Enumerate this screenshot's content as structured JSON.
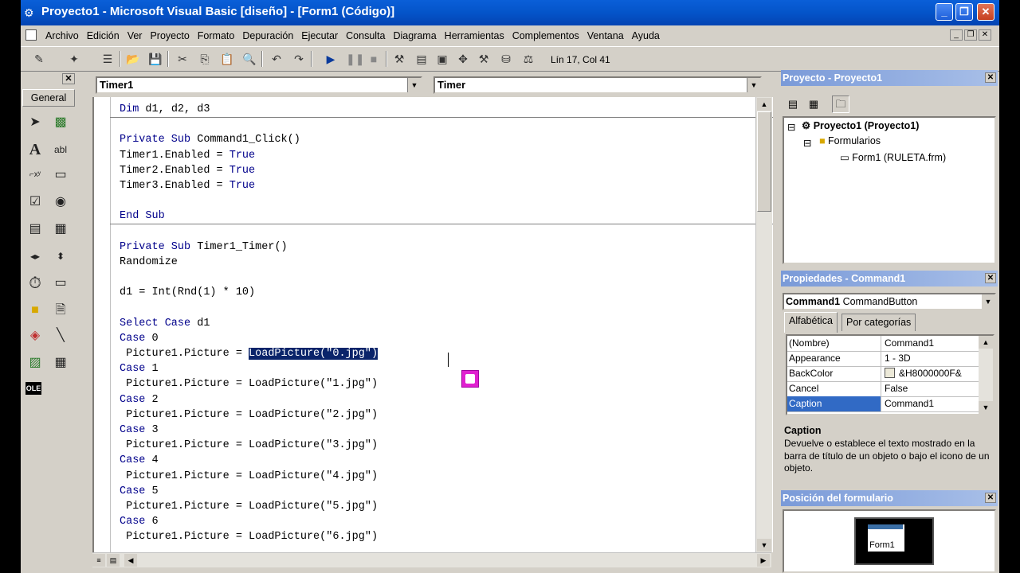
{
  "window": {
    "title": "Proyecto1 - Microsoft Visual Basic [diseño] - [Form1 (Código)]",
    "min_label": "_",
    "max_label": "❐",
    "close_label": "✕"
  },
  "menu": [
    "Archivo",
    "Edición",
    "Ver",
    "Proyecto",
    "Formato",
    "Depuración",
    "Ejecutar",
    "Consulta",
    "Diagrama",
    "Herramientas",
    "Complementos",
    "Ventana",
    "Ayuda"
  ],
  "toolbar": {
    "position_label": "Lín 17, Col 41"
  },
  "toolbox": {
    "close_label": "✕",
    "tab_label": "General"
  },
  "code_window": {
    "object_combo": "Timer1",
    "procedure_combo": "Timer",
    "lines": [
      {
        "text": "Dim d1, d2, d3",
        "kw": "Dim"
      },
      {
        "text": "",
        "kw": ""
      },
      {
        "text": "Private Sub Command1_Click()",
        "kw": "Private Sub"
      },
      {
        "text": "Timer1.Enabled = True",
        "kw": ""
      },
      {
        "text": "Timer2.Enabled = True",
        "kw": ""
      },
      {
        "text": "Timer3.Enabled = True",
        "kw": ""
      },
      {
        "text": "",
        "kw": ""
      },
      {
        "text": "End Sub",
        "kw": "End Sub"
      },
      {
        "text": "",
        "kw": ""
      },
      {
        "text": "Private Sub Timer1_Timer()",
        "kw": "Private Sub"
      },
      {
        "text": "Randomize",
        "kw": ""
      },
      {
        "text": "",
        "kw": ""
      },
      {
        "text": "d1 = Int(Rnd(1) * 10)",
        "kw": ""
      },
      {
        "text": "",
        "kw": ""
      },
      {
        "text": "Select Case d1",
        "kw": "Select Case"
      },
      {
        "text": "Case 0",
        "kw": "Case"
      },
      {
        "text": " Picture1.Picture = LoadPicture(\"0.jpg\")",
        "kw": ""
      },
      {
        "text": "Case 1",
        "kw": "Case"
      },
      {
        "text": " Picture1.Picture = LoadPicture(\"1.jpg\")",
        "kw": ""
      },
      {
        "text": "Case 2",
        "kw": "Case"
      },
      {
        "text": " Picture1.Picture = LoadPicture(\"2.jpg\")",
        "kw": ""
      },
      {
        "text": "Case 3",
        "kw": "Case"
      },
      {
        "text": " Picture1.Picture = LoadPicture(\"3.jpg\")",
        "kw": ""
      },
      {
        "text": "Case 4",
        "kw": "Case"
      },
      {
        "text": " Picture1.Picture = LoadPicture(\"4.jpg\")",
        "kw": ""
      },
      {
        "text": "Case 5",
        "kw": "Case"
      },
      {
        "text": " Picture1.Picture = LoadPicture(\"5.jpg\")",
        "kw": ""
      },
      {
        "text": "Case 6",
        "kw": "Case"
      },
      {
        "text": " Picture1.Picture = LoadPicture(\"6.jpg\")",
        "kw": ""
      }
    ],
    "selected_text": "LoadPicture(\"0.jpg\")"
  },
  "project_panel": {
    "title": "Proyecto - Proyecto1",
    "tree": {
      "root": "Proyecto1 (Proyecto1)",
      "folder": "Formularios",
      "item": "Form1 (RULETA.frm)"
    }
  },
  "properties_panel": {
    "title": "Propiedades - Command1",
    "object_name": "Command1",
    "object_type": "CommandButton",
    "tabs": [
      "Alfabética",
      "Por categorías"
    ],
    "rows": [
      {
        "name": "(Nombre)",
        "value": "Command1"
      },
      {
        "name": "Appearance",
        "value": "1 - 3D"
      },
      {
        "name": "BackColor",
        "value": "&H8000000F&"
      },
      {
        "name": "Cancel",
        "value": "False"
      },
      {
        "name": "Caption",
        "value": "Command1"
      }
    ],
    "selected_row": 4,
    "description_title": "Caption",
    "description_text": "Devuelve o establece el texto mostrado en la barra de título de un objeto o bajo el icono de un objeto."
  },
  "form_position_panel": {
    "title": "Posición del formulario",
    "form_label": "Form1"
  },
  "colors": {
    "titlebar": "#0454c9",
    "keyword": "#00008b",
    "selection": "#0a246a",
    "chrome": "#d4d0c8"
  }
}
